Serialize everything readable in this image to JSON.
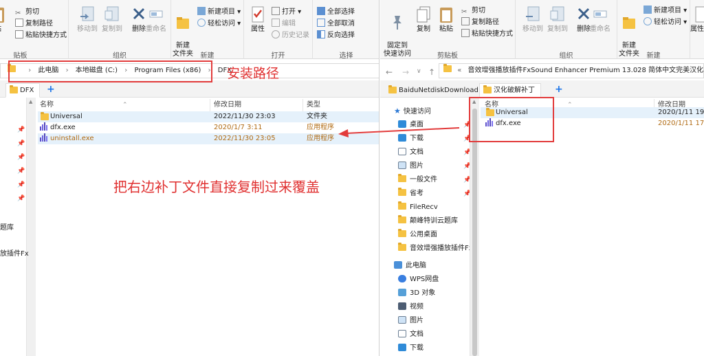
{
  "left_window": {
    "ribbon": {
      "clipboard": {
        "partial_label": "贴板",
        "cut": "剪切",
        "copy_path": "复制路径",
        "paste_shortcut": "粘贴快捷方式",
        "paste": "贴"
      },
      "organize": {
        "label": "组织",
        "move_to": "移动到",
        "copy_to": "复制到",
        "delete": "删除",
        "rename": "重命名"
      },
      "new": {
        "label": "新建",
        "new_folder": "新建\n文件夹",
        "new_item": "新建项目 ▾",
        "easy_access": "轻松访问 ▾"
      },
      "open": {
        "label": "打开",
        "properties": "属性",
        "open": "打开 ▾",
        "edit": "编辑",
        "history": "历史记录"
      },
      "select": {
        "label": "选择",
        "select_all": "全部选择",
        "select_none": "全部取消",
        "invert": "反向选择"
      }
    },
    "breadcrumb": [
      "此电脑",
      "本地磁盘 (C:)",
      "Program Files (x86)",
      "DFX"
    ],
    "tab": "DFX",
    "tab_add": "+",
    "columns": {
      "name": "名称",
      "date": "修改日期",
      "type": "类型"
    },
    "files": [
      {
        "name": "Universal",
        "date": "2022/11/30 23:03",
        "type": "文件夹",
        "icon": "folder-icon"
      },
      {
        "name": "dfx.exe",
        "date": "2020/1/7 3:11",
        "type": "应用程序",
        "icon": "app-icon"
      },
      {
        "name": "uninstall.exe",
        "date": "2022/11/30 23:05",
        "type": "应用程序",
        "icon": "app-icon"
      }
    ],
    "nav_truncated": [
      "题库",
      "放插件Fx"
    ]
  },
  "right_window": {
    "ribbon": {
      "clipboard": {
        "label": "剪贴板",
        "pin": "固定到\n快速访问",
        "copy": "复制",
        "paste": "粘贴",
        "cut": "剪切",
        "copy_path": "复制路径",
        "paste_shortcut": "粘贴快捷方式"
      },
      "organize": {
        "label": "组织",
        "move_to": "移动到",
        "copy_to": "复制到",
        "delete": "删除",
        "rename": "重命名"
      },
      "new": {
        "label": "新建",
        "new_folder": "新建\n文件夹",
        "new_item": "新建项目 ▾",
        "easy_access": "轻松访问 ▾"
      },
      "properties": "属性"
    },
    "address": "音效增强播放插件FxSound Enhancer Premium 13.028 简体中文完美汉化版",
    "address_prefix": "«",
    "tabs": [
      "BaiduNetdiskDownload",
      "汉化破解补丁"
    ],
    "tab_add": "+",
    "columns": {
      "name": "名称",
      "date": "修改日期"
    },
    "files": [
      {
        "name": "Universal",
        "date": "2020/1/11 19:",
        "icon": "folder-icon"
      },
      {
        "name": "dfx.exe",
        "date": "2020/1/11 17:",
        "icon": "app-icon"
      }
    ],
    "quick_access": "快速访问",
    "nav_items": [
      {
        "label": "桌面",
        "icon": "desktop-icon",
        "pinned": true
      },
      {
        "label": "下载",
        "icon": "download-icon",
        "pinned": true
      },
      {
        "label": "文档",
        "icon": "document-icon",
        "pinned": true
      },
      {
        "label": "图片",
        "icon": "picture-icon",
        "pinned": true
      },
      {
        "label": "一般文件",
        "icon": "folder-icon",
        "pinned": true
      },
      {
        "label": "省考",
        "icon": "folder-icon",
        "pinned": true
      },
      {
        "label": "FileRecv",
        "icon": "folder-icon",
        "pinned": false
      },
      {
        "label": "颠峰特训云题库",
        "icon": "folder-icon",
        "pinned": false
      },
      {
        "label": "公用桌面",
        "icon": "folder-icon",
        "pinned": false
      },
      {
        "label": "音效增强播放插件Fx",
        "icon": "folder-icon",
        "pinned": false
      }
    ],
    "this_pc": "此电脑",
    "pc_items": [
      {
        "label": "WPS网盘",
        "icon": "cloud-icon"
      },
      {
        "label": "3D 对象",
        "icon": "cube-icon"
      },
      {
        "label": "视频",
        "icon": "video-icon"
      },
      {
        "label": "图片",
        "icon": "picture-icon"
      },
      {
        "label": "文档",
        "icon": "document-icon"
      },
      {
        "label": "下载",
        "icon": "download-icon"
      }
    ]
  },
  "annotations": {
    "install_path": "安装路径",
    "copy_patch": "把右边补丁文件直接复制过来覆盖"
  },
  "colors": {
    "annotation": "#e03030",
    "exe_date": "#b06a12",
    "selection": "#e5f1fb"
  }
}
